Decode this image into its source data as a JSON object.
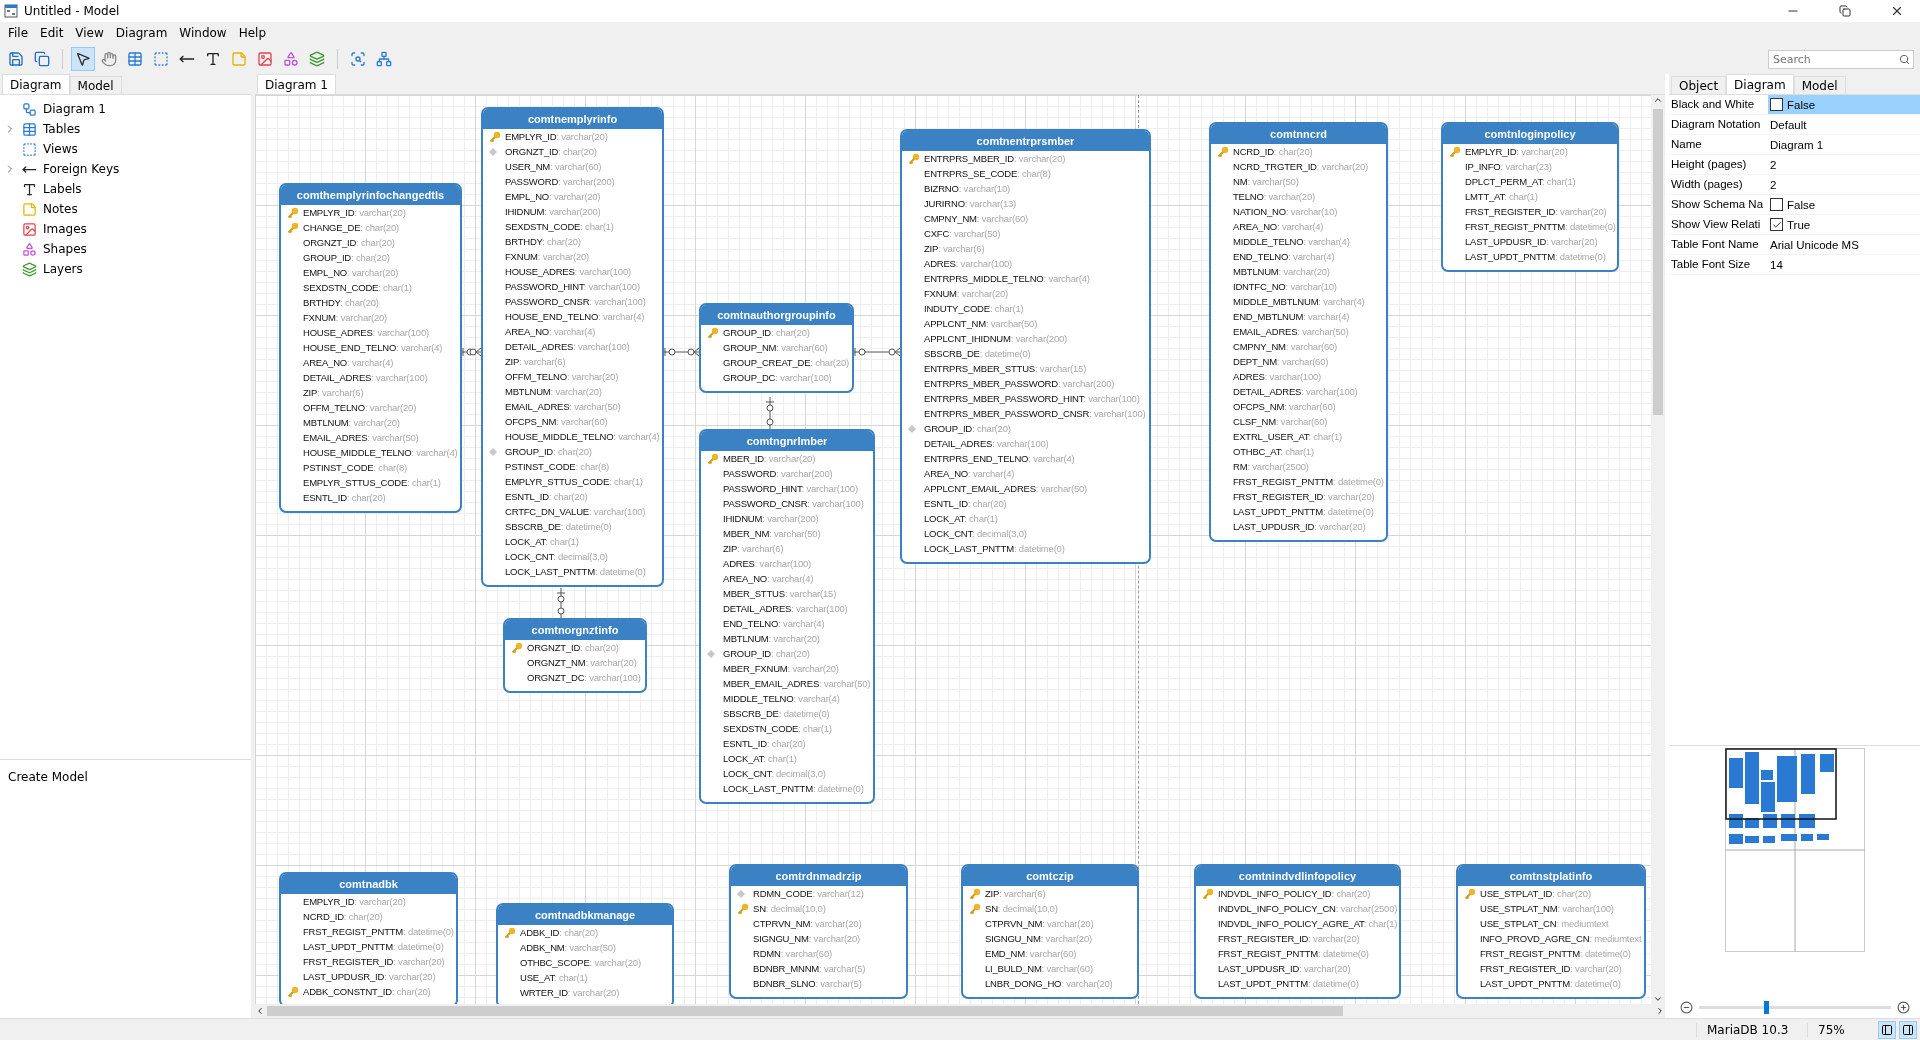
{
  "window": {
    "title": "Untitled - Model"
  },
  "menu": [
    "File",
    "Edit",
    "View",
    "Diagram",
    "Window",
    "Help"
  ],
  "toolbar": [
    {
      "kind": "save",
      "selected": false
    },
    {
      "kind": "save-all",
      "selected": false
    },
    {
      "kind": "pointer",
      "selected": true
    },
    {
      "kind": "hand",
      "selected": false
    },
    {
      "kind": "table",
      "selected": false
    },
    {
      "kind": "view",
      "selected": false
    },
    {
      "kind": "fk",
      "selected": false
    },
    {
      "kind": "label",
      "selected": false
    },
    {
      "kind": "note",
      "selected": false
    },
    {
      "kind": "image",
      "selected": false
    },
    {
      "kind": "shape",
      "selected": false
    },
    {
      "kind": "layer",
      "selected": false
    },
    {
      "kind": "auto-layout",
      "selected": false
    },
    {
      "kind": "diagram-settings",
      "selected": false
    }
  ],
  "search": {
    "placeholder": "Search"
  },
  "left_tabs": [
    {
      "label": "Diagram",
      "selected": true
    },
    {
      "label": "Model",
      "selected": false
    }
  ],
  "tree": [
    {
      "kind": "diagram",
      "label": "Diagram 1",
      "has_children": false
    },
    {
      "kind": "tables",
      "label": "Tables",
      "has_children": true
    },
    {
      "kind": "views",
      "label": "Views",
      "has_children": false
    },
    {
      "kind": "fk",
      "label": "Foreign Keys",
      "has_children": true
    },
    {
      "kind": "labels",
      "label": "Labels",
      "has_children": false
    },
    {
      "kind": "notes",
      "label": "Notes",
      "has_children": false
    },
    {
      "kind": "images",
      "label": "Images",
      "has_children": false
    },
    {
      "kind": "shapes",
      "label": "Shapes",
      "has_children": false
    },
    {
      "kind": "layers",
      "label": "Layers",
      "has_children": false
    }
  ],
  "bottom_left": {
    "label": "Create Model"
  },
  "canvas_tabs": [
    {
      "label": "Diagram 1",
      "selected": true
    }
  ],
  "tables": [
    {
      "name": "comthemplyrinfochangedtls",
      "columns": [
        {
          "name": "EMPLYR_ID",
          "type": ": varchar(20)",
          "kind": "primary"
        },
        {
          "name": "CHANGE_DE",
          "type": ": char(20)",
          "kind": "primary"
        },
        {
          "name": "ORGNZT_ID",
          "type": ": char(20)",
          "kind": "plain"
        },
        {
          "name": "GROUP_ID",
          "type": ": char(20)",
          "kind": "plain"
        },
        {
          "name": "EMPL_NO",
          "type": ": varchar(20)",
          "kind": "plain"
        },
        {
          "name": "SEXDSTN_CODE",
          "type": ": char(1)",
          "kind": "plain"
        },
        {
          "name": "BRTHDY",
          "type": ": char(20)",
          "kind": "plain"
        },
        {
          "name": "FXNUM",
          "type": ": varchar(20)",
          "kind": "plain"
        },
        {
          "name": "HOUSE_ADRES",
          "type": ": varchar(100)",
          "kind": "plain"
        },
        {
          "name": "HOUSE_END_TELNO",
          "type": ": varchar(4)",
          "kind": "plain"
        },
        {
          "name": "AREA_NO",
          "type": ": varchar(4)",
          "kind": "plain"
        },
        {
          "name": "DETAIL_ADRES",
          "type": ": varchar(100)",
          "kind": "plain"
        },
        {
          "name": "ZIP",
          "type": ": varchar(6)",
          "kind": "plain"
        },
        {
          "name": "OFFM_TELNO",
          "type": ": varchar(20)",
          "kind": "plain"
        },
        {
          "name": "MBTLNUM",
          "type": ": varchar(20)",
          "kind": "plain"
        },
        {
          "name": "EMAIL_ADRES",
          "type": ": varchar(50)",
          "kind": "plain"
        },
        {
          "name": "HOUSE_MIDDLE_TELNO",
          "type": ": varchar(4)",
          "kind": "plain"
        },
        {
          "name": "PSTINST_CODE",
          "type": ": char(8)",
          "kind": "plain"
        },
        {
          "name": "EMPLYR_STTUS_CODE",
          "type": ": char(1)",
          "kind": "plain"
        },
        {
          "name": "ESNTL_ID",
          "type": ": char(20)",
          "kind": "plain"
        }
      ]
    },
    {
      "name": "comtnemplyrinfo",
      "columns": [
        {
          "name": "EMPLYR_ID",
          "type": ": varchar(20)",
          "kind": "primary"
        },
        {
          "name": "ORGNZT_ID",
          "type": ": char(20)",
          "kind": "foreign"
        },
        {
          "name": "USER_NM",
          "type": ": varchar(60)",
          "kind": "plain"
        },
        {
          "name": "PASSWORD",
          "type": ": varchar(200)",
          "kind": "plain"
        },
        {
          "name": "EMPL_NO",
          "type": ": varchar(20)",
          "kind": "plain"
        },
        {
          "name": "IHIDNUM",
          "type": ": varchar(200)",
          "kind": "plain"
        },
        {
          "name": "SEXDSTN_CODE",
          "type": ": char(1)",
          "kind": "plain"
        },
        {
          "name": "BRTHDY",
          "type": ": char(20)",
          "kind": "plain"
        },
        {
          "name": "FXNUM",
          "type": ": varchar(20)",
          "kind": "plain"
        },
        {
          "name": "HOUSE_ADRES",
          "type": ": varchar(100)",
          "kind": "plain"
        },
        {
          "name": "PASSWORD_HINT",
          "type": ": varchar(100)",
          "kind": "plain"
        },
        {
          "name": "PASSWORD_CNSR",
          "type": ": varchar(100)",
          "kind": "plain"
        },
        {
          "name": "HOUSE_END_TELNO",
          "type": ": varchar(4)",
          "kind": "plain"
        },
        {
          "name": "AREA_NO",
          "type": ": varchar(4)",
          "kind": "plain"
        },
        {
          "name": "DETAIL_ADRES",
          "type": ": varchar(100)",
          "kind": "plain"
        },
        {
          "name": "ZIP",
          "type": ": varchar(6)",
          "kind": "plain"
        },
        {
          "name": "OFFM_TELNO",
          "type": ": varchar(20)",
          "kind": "plain"
        },
        {
          "name": "MBTLNUM",
          "type": ": varchar(20)",
          "kind": "plain"
        },
        {
          "name": "EMAIL_ADRES",
          "type": ": varchar(50)",
          "kind": "plain"
        },
        {
          "name": "OFCPS_NM",
          "type": ": varchar(60)",
          "kind": "plain"
        },
        {
          "name": "HOUSE_MIDDLE_TELNO",
          "type": ": varchar(4)",
          "kind": "plain"
        },
        {
          "name": "GROUP_ID",
          "type": ": char(20)",
          "kind": "foreign"
        },
        {
          "name": "PSTINST_CODE",
          "type": ": char(8)",
          "kind": "plain"
        },
        {
          "name": "EMPLYR_STTUS_CODE",
          "type": ": char(1)",
          "kind": "plain"
        },
        {
          "name": "ESNTL_ID",
          "type": ": char(20)",
          "kind": "plain"
        },
        {
          "name": "CRTFC_DN_VALUE",
          "type": ": varchar(100)",
          "kind": "plain"
        },
        {
          "name": "SBSCRB_DE",
          "type": ": datetime(0)",
          "kind": "plain"
        },
        {
          "name": "LOCK_AT",
          "type": ": char(1)",
          "kind": "plain"
        },
        {
          "name": "LOCK_CNT",
          "type": ": decimal(3,0)",
          "kind": "plain"
        },
        {
          "name": "LOCK_LAST_PNTTM",
          "type": ": datetime(0)",
          "kind": "plain"
        }
      ]
    },
    {
      "name": "comtnorgnztinfo",
      "columns": [
        {
          "name": "ORGNZT_ID",
          "type": ": char(20)",
          "kind": "primary"
        },
        {
          "name": "ORGNZT_NM",
          "type": ": varchar(20)",
          "kind": "plain"
        },
        {
          "name": "ORGNZT_DC",
          "type": ": varchar(100)",
          "kind": "plain"
        }
      ]
    },
    {
      "name": "comtnauthorgroupinfo",
      "columns": [
        {
          "name": "GROUP_ID",
          "type": ": char(20)",
          "kind": "primary"
        },
        {
          "name": "GROUP_NM",
          "type": ": varchar(60)",
          "kind": "plain"
        },
        {
          "name": "GROUP_CREAT_DE",
          "type": ": char(20)",
          "kind": "plain"
        },
        {
          "name": "GROUP_DC",
          "type": ": varchar(100)",
          "kind": "plain"
        }
      ]
    },
    {
      "name": "comtngnrlmber",
      "columns": [
        {
          "name": "MBER_ID",
          "type": ": varchar(20)",
          "kind": "primary"
        },
        {
          "name": "PASSWORD",
          "type": ": varchar(200)",
          "kind": "plain"
        },
        {
          "name": "PASSWORD_HINT",
          "type": ": varchar(100)",
          "kind": "plain"
        },
        {
          "name": "PASSWORD_CNSR",
          "type": ": varchar(100)",
          "kind": "plain"
        },
        {
          "name": "IHIDNUM",
          "type": ": varchar(200)",
          "kind": "plain"
        },
        {
          "name": "MBER_NM",
          "type": ": varchar(50)",
          "kind": "plain"
        },
        {
          "name": "ZIP",
          "type": ": varchar(6)",
          "kind": "plain"
        },
        {
          "name": "ADRES",
          "type": ": varchar(100)",
          "kind": "plain"
        },
        {
          "name": "AREA_NO",
          "type": ": varchar(4)",
          "kind": "plain"
        },
        {
          "name": "MBER_STTUS",
          "type": ": varchar(15)",
          "kind": "plain"
        },
        {
          "name": "DETAIL_ADRES",
          "type": ": varchar(100)",
          "kind": "plain"
        },
        {
          "name": "END_TELNO",
          "type": ": varchar(4)",
          "kind": "plain"
        },
        {
          "name": "MBTLNUM",
          "type": ": varchar(20)",
          "kind": "plain"
        },
        {
          "name": "GROUP_ID",
          "type": ": char(20)",
          "kind": "foreign"
        },
        {
          "name": "MBER_FXNUM",
          "type": ": varchar(20)",
          "kind": "plain"
        },
        {
          "name": "MBER_EMAIL_ADRES",
          "type": ": varchar(50)",
          "kind": "plain"
        },
        {
          "name": "MIDDLE_TELNO",
          "type": ": varchar(4)",
          "kind": "plain"
        },
        {
          "name": "SBSCRB_DE",
          "type": ": datetime(0)",
          "kind": "plain"
        },
        {
          "name": "SEXDSTN_CODE",
          "type": ": char(1)",
          "kind": "plain"
        },
        {
          "name": "ESNTL_ID",
          "type": ": char(20)",
          "kind": "plain"
        },
        {
          "name": "LOCK_AT",
          "type": ": char(1)",
          "kind": "plain"
        },
        {
          "name": "LOCK_CNT",
          "type": ": decimal(3,0)",
          "kind": "plain"
        },
        {
          "name": "LOCK_LAST_PNTTM",
          "type": ": datetime(0)",
          "kind": "plain"
        }
      ]
    },
    {
      "name": "comtnentrprsmber",
      "columns": [
        {
          "name": "ENTRPRS_MBER_ID",
          "type": ": varchar(20)",
          "kind": "primary"
        },
        {
          "name": "ENTRPRS_SE_CODE",
          "type": ": char(8)",
          "kind": "plain"
        },
        {
          "name": "BIZRNO",
          "type": ": varchar(10)",
          "kind": "plain"
        },
        {
          "name": "JURIRNO",
          "type": ": varchar(13)",
          "kind": "plain"
        },
        {
          "name": "CMPNY_NM",
          "type": ": varchar(60)",
          "kind": "plain"
        },
        {
          "name": "CXFC",
          "type": ": varchar(50)",
          "kind": "plain"
        },
        {
          "name": "ZIP",
          "type": ": varchar(6)",
          "kind": "plain"
        },
        {
          "name": "ADRES",
          "type": ": varchar(100)",
          "kind": "plain"
        },
        {
          "name": "ENTRPRS_MIDDLE_TELNO",
          "type": ": varchar(4)",
          "kind": "plain"
        },
        {
          "name": "FXNUM",
          "type": ": varchar(20)",
          "kind": "plain"
        },
        {
          "name": "INDUTY_CODE",
          "type": ": char(1)",
          "kind": "plain"
        },
        {
          "name": "APPLCNT_NM",
          "type": ": varchar(50)",
          "kind": "plain"
        },
        {
          "name": "APPLCNT_IHIDNUM",
          "type": ": varchar(200)",
          "kind": "plain"
        },
        {
          "name": "SBSCRB_DE",
          "type": ": datetime(0)",
          "kind": "plain"
        },
        {
          "name": "ENTRPRS_MBER_STTUS",
          "type": ": varchar(15)",
          "kind": "plain"
        },
        {
          "name": "ENTRPRS_MBER_PASSWORD",
          "type": ": varchar(200)",
          "kind": "plain"
        },
        {
          "name": "ENTRPRS_MBER_PASSWORD_HINT",
          "type": ": varchar(100)",
          "kind": "plain"
        },
        {
          "name": "ENTRPRS_MBER_PASSWORD_CNSR",
          "type": ": varchar(100)",
          "kind": "plain"
        },
        {
          "name": "GROUP_ID",
          "type": ": char(20)",
          "kind": "foreign"
        },
        {
          "name": "DETAIL_ADRES",
          "type": ": varchar(100)",
          "kind": "plain"
        },
        {
          "name": "ENTRPRS_END_TELNO",
          "type": ": varchar(4)",
          "kind": "plain"
        },
        {
          "name": "AREA_NO",
          "type": ": varchar(4)",
          "kind": "plain"
        },
        {
          "name": "APPLCNT_EMAIL_ADRES",
          "type": ": varchar(50)",
          "kind": "plain"
        },
        {
          "name": "ESNTL_ID",
          "type": ": char(20)",
          "kind": "plain"
        },
        {
          "name": "LOCK_AT",
          "type": ": char(1)",
          "kind": "plain"
        },
        {
          "name": "LOCK_CNT",
          "type": ": decimal(3,0)",
          "kind": "plain"
        },
        {
          "name": "LOCK_LAST_PNTTM",
          "type": ": datetime(0)",
          "kind": "plain"
        }
      ]
    },
    {
      "name": "comtnncrd",
      "columns": [
        {
          "name": "NCRD_ID",
          "type": ": char(20)",
          "kind": "primary"
        },
        {
          "name": "NCRD_TRGTER_ID",
          "type": ": varchar(20)",
          "kind": "plain"
        },
        {
          "name": "NM",
          "type": ": varchar(50)",
          "kind": "plain"
        },
        {
          "name": "TELNO",
          "type": ": varchar(20)",
          "kind": "plain"
        },
        {
          "name": "NATION_NO",
          "type": ": varchar(10)",
          "kind": "plain"
        },
        {
          "name": "AREA_NO",
          "type": ": varchar(4)",
          "kind": "plain"
        },
        {
          "name": "MIDDLE_TELNO",
          "type": ": varchar(4)",
          "kind": "plain"
        },
        {
          "name": "END_TELNO",
          "type": ": varchar(4)",
          "kind": "plain"
        },
        {
          "name": "MBTLNUM",
          "type": ": varchar(20)",
          "kind": "plain"
        },
        {
          "name": "IDNTFC_NO",
          "type": ": varchar(10)",
          "kind": "plain"
        },
        {
          "name": "MIDDLE_MBTLNUM",
          "type": ": varchar(4)",
          "kind": "plain"
        },
        {
          "name": "END_MBTLNUM",
          "type": ": varchar(4)",
          "kind": "plain"
        },
        {
          "name": "EMAIL_ADRES",
          "type": ": varchar(50)",
          "kind": "plain"
        },
        {
          "name": "CMPNY_NM",
          "type": ": varchar(60)",
          "kind": "plain"
        },
        {
          "name": "DEPT_NM",
          "type": ": varchar(60)",
          "kind": "plain"
        },
        {
          "name": "ADRES",
          "type": ": varchar(100)",
          "kind": "plain"
        },
        {
          "name": "DETAIL_ADRES",
          "type": ": varchar(100)",
          "kind": "plain"
        },
        {
          "name": "OFCPS_NM",
          "type": ": varchar(60)",
          "kind": "plain"
        },
        {
          "name": "CLSF_NM",
          "type": ": varchar(60)",
          "kind": "plain"
        },
        {
          "name": "EXTRL_USER_AT",
          "type": ": char(1)",
          "kind": "plain"
        },
        {
          "name": "OTHBC_AT",
          "type": ": char(1)",
          "kind": "plain"
        },
        {
          "name": "RM",
          "type": ": varchar(2500)",
          "kind": "plain"
        },
        {
          "name": "FRST_REGIST_PNTTM",
          "type": ": datetime(0)",
          "kind": "plain"
        },
        {
          "name": "FRST_REGISTER_ID",
          "type": ": varchar(20)",
          "kind": "plain"
        },
        {
          "name": "LAST_UPDT_PNTTM",
          "type": ": datetime(0)",
          "kind": "plain"
        },
        {
          "name": "LAST_UPDUSR_ID",
          "type": ": varchar(20)",
          "kind": "plain"
        }
      ]
    },
    {
      "name": "comtnloginpolicy",
      "columns": [
        {
          "name": "EMPLYR_ID",
          "type": ": varchar(20)",
          "kind": "primary"
        },
        {
          "name": "IP_INFO",
          "type": ": varchar(23)",
          "kind": "plain"
        },
        {
          "name": "DPLCT_PERM_AT",
          "type": ": char(1)",
          "kind": "plain"
        },
        {
          "name": "LMTT_AT",
          "type": ": char(1)",
          "kind": "plain"
        },
        {
          "name": "FRST_REGISTER_ID",
          "type": ": varchar(20)",
          "kind": "plain"
        },
        {
          "name": "FRST_REGIST_PNTTM",
          "type": ": datetime(0)",
          "kind": "plain"
        },
        {
          "name": "LAST_UPDUSR_ID",
          "type": ": varchar(20)",
          "kind": "plain"
        },
        {
          "name": "LAST_UPDT_PNTTM",
          "type": ": datetime(0)",
          "kind": "plain"
        }
      ]
    },
    {
      "name": "comtnadbk",
      "columns": [
        {
          "name": "EMPLYR_ID",
          "type": ": varchar(20)",
          "kind": "plain"
        },
        {
          "name": "NCRD_ID",
          "type": ": char(20)",
          "kind": "plain"
        },
        {
          "name": "FRST_REGIST_PNTTM",
          "type": ": datetime(0)",
          "kind": "plain"
        },
        {
          "name": "LAST_UPDT_PNTTM",
          "type": ": datetime(0)",
          "kind": "plain"
        },
        {
          "name": "FRST_REGISTER_ID",
          "type": ": varchar(20)",
          "kind": "plain"
        },
        {
          "name": "LAST_UPDUSR_ID",
          "type": ": varchar(20)",
          "kind": "plain"
        },
        {
          "name": "ADBK_CONSTNT_ID",
          "type": ": char(20)",
          "kind": "primary"
        }
      ]
    },
    {
      "name": "comtnadbkmanage",
      "columns": [
        {
          "name": "ADBK_ID",
          "type": ": char(20)",
          "kind": "primary"
        },
        {
          "name": "ADBK_NM",
          "type": ": varchar(50)",
          "kind": "plain"
        },
        {
          "name": "OTHBC_SCOPE",
          "type": ": varchar(20)",
          "kind": "plain"
        },
        {
          "name": "USE_AT",
          "type": ": char(1)",
          "kind": "plain"
        },
        {
          "name": "WRTER_ID",
          "type": ": varchar(20)",
          "kind": "plain"
        }
      ]
    },
    {
      "name": "comtrdnmadrzip",
      "columns": [
        {
          "name": "RDMN_CODE",
          "type": ": varchar(12)",
          "kind": "foreign"
        },
        {
          "name": "SN",
          "type": ": decimal(10,0)",
          "kind": "primary"
        },
        {
          "name": "CTPRVN_NM",
          "type": ": varchar(20)",
          "kind": "plain"
        },
        {
          "name": "SIGNGU_NM",
          "type": ": varchar(20)",
          "kind": "plain"
        },
        {
          "name": "RDMN",
          "type": ": varchar(60)",
          "kind": "plain"
        },
        {
          "name": "BDNBR_MNNM",
          "type": ": varchar(5)",
          "kind": "plain"
        },
        {
          "name": "BDNBR_SLNO",
          "type": ": varchar(5)",
          "kind": "plain"
        }
      ]
    },
    {
      "name": "comtczip",
      "columns": [
        {
          "name": "ZIP",
          "type": ": varchar(6)",
          "kind": "primary"
        },
        {
          "name": "SN",
          "type": ": decimal(10,0)",
          "kind": "primary"
        },
        {
          "name": "CTPRVN_NM",
          "type": ": varchar(20)",
          "kind": "plain"
        },
        {
          "name": "SIGNGU_NM",
          "type": ": varchar(20)",
          "kind": "plain"
        },
        {
          "name": "EMD_NM",
          "type": ": varchar(60)",
          "kind": "plain"
        },
        {
          "name": "LI_BULD_NM",
          "type": ": varchar(60)",
          "kind": "plain"
        },
        {
          "name": "LNBR_DONG_HO",
          "type": ": varchar(20)",
          "kind": "plain"
        }
      ]
    },
    {
      "name": "comtnindvdlinfopolicy",
      "columns": [
        {
          "name": "INDVDL_INFO_POLICY_ID",
          "type": ": char(20)",
          "kind": "primary"
        },
        {
          "name": "INDVDL_INFO_POLICY_CN",
          "type": ": varchar(2500)",
          "kind": "plain"
        },
        {
          "name": "INDVDL_INFO_POLICY_AGRE_AT",
          "type": ": char(1)",
          "kind": "plain"
        },
        {
          "name": "FRST_REGISTER_ID",
          "type": ": varchar(20)",
          "kind": "plain"
        },
        {
          "name": "FRST_REGIST_PNTTM",
          "type": ": datetime(0)",
          "kind": "plain"
        },
        {
          "name": "LAST_UPDUSR_ID",
          "type": ": varchar(20)",
          "kind": "plain"
        },
        {
          "name": "LAST_UPDT_PNTTM",
          "type": ": datetime(0)",
          "kind": "plain"
        }
      ]
    },
    {
      "name": "comtnstplatinfo",
      "columns": [
        {
          "name": "USE_STPLAT_ID",
          "type": ": char(20)",
          "kind": "primary"
        },
        {
          "name": "USE_STPLAT_NM",
          "type": ": varchar(100)",
          "kind": "plain"
        },
        {
          "name": "USE_STPLAT_CN",
          "type": ": mediumtext",
          "kind": "plain"
        },
        {
          "name": "INFO_PROVD_AGRE_CN",
          "type": ": mediumtext",
          "kind": "plain"
        },
        {
          "name": "FRST_REGIST_PNTTM",
          "type": ": datetime(0)",
          "kind": "plain"
        },
        {
          "name": "FRST_REGISTER_ID",
          "type": ": varchar(20)",
          "kind": "plain"
        },
        {
          "name": "LAST_UPDT_PNTTM",
          "type": ": datetime(0)",
          "kind": "plain"
        }
      ]
    }
  ],
  "right_tabs": [
    {
      "label": "Object",
      "selected": false
    },
    {
      "label": "Diagram",
      "selected": true
    },
    {
      "label": "Model",
      "selected": false
    }
  ],
  "properties": [
    {
      "name": "Black and White",
      "kind": "checkbox",
      "checked": false,
      "value": "False",
      "selected": true
    },
    {
      "name": "Diagram Notation",
      "kind": "text",
      "value": "Default",
      "selected": false
    },
    {
      "name": "Name",
      "kind": "text",
      "value": "Diagram 1",
      "selected": false
    },
    {
      "name": "Height (pages)",
      "kind": "text",
      "value": "2",
      "selected": false
    },
    {
      "name": "Width (pages)",
      "kind": "text",
      "value": "2",
      "selected": false
    },
    {
      "name": "Show Schema Na",
      "kind": "checkbox",
      "checked": false,
      "value": "False",
      "selected": false
    },
    {
      "name": "Show View Relati",
      "kind": "checkbox",
      "checked": true,
      "value": "True",
      "selected": false
    },
    {
      "name": "Table Font Name",
      "kind": "text",
      "value": "Arial Unicode MS",
      "selected": false
    },
    {
      "name": "Table Font Size",
      "kind": "text",
      "value": "14",
      "selected": false
    }
  ],
  "zoom_slider": {
    "level": 0.35
  },
  "status_bar": {
    "database": "MariaDB 10.3",
    "zoom": "75%"
  }
}
